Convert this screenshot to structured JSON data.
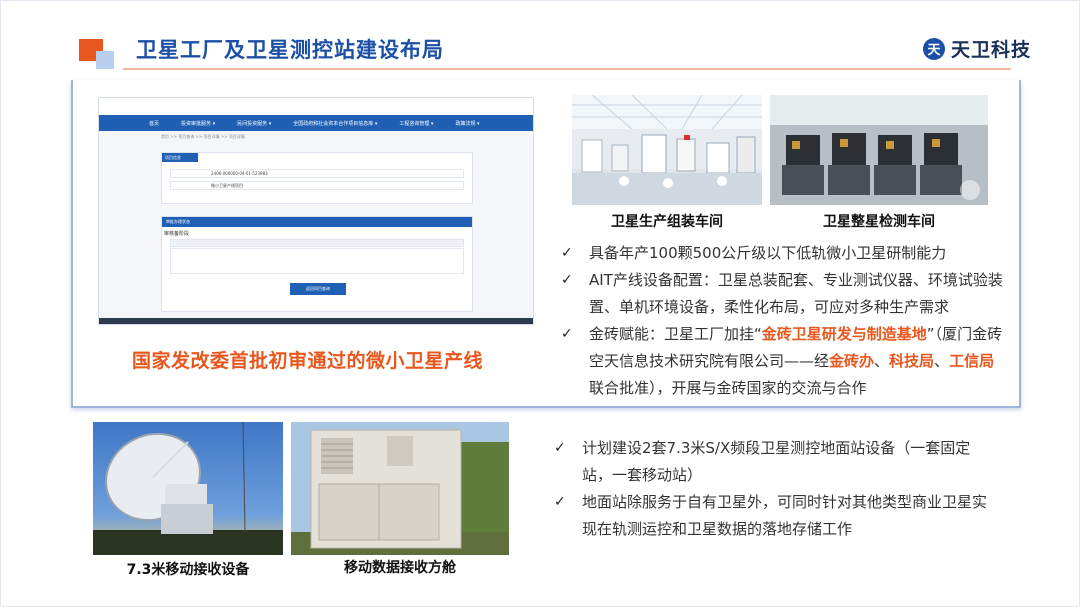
{
  "slide": {
    "title": "卫星工厂及卫星测控站建设布局",
    "logo_mark": "天",
    "logo_text": "天卫科技"
  },
  "website": {
    "nav": [
      "首页",
      "投资审批服务 ▾",
      "民间投资服务 ▾",
      "全国政府和社会资本合作项目信息库 ▾",
      "工程咨询管理 ▾",
      "政策法规 ▾"
    ],
    "crumb": "首页 >> 项目查询 >> 项目详情 >> 项目详情",
    "project_info_label": "项目信息",
    "rows": [
      {
        "label": "项目代码",
        "value": "2406-000000-04-01-523983"
      },
      {
        "label": "项目名称",
        "value": "微小卫星产线项目"
      }
    ],
    "status_bar": "审批办理状态",
    "stage_label": "审核备阶段",
    "submit_button": "返回项目查询"
  },
  "left_caption": "国家发改委首批初审通过的微小卫星产线",
  "photos": {
    "workshop_caption": "卫星生产组装车间",
    "test_caption": "卫星整星检测车间",
    "antenna_caption": "7.3米移动接收设备",
    "cabin_caption": "移动数据接收方舱"
  },
  "check_mark": "✓",
  "bullets_top": [
    {
      "parts": [
        {
          "t": "具备年产100颗500公斤级以下低轨微小卫星研制能力",
          "hl": false
        }
      ]
    },
    {
      "parts": [
        {
          "t": "AIT产线设备配置：卫星总装配套、专业测试仪器、环境试验装置、单机环境设备，柔性化布局，可应对多种生产需求",
          "hl": false
        }
      ]
    },
    {
      "parts": [
        {
          "t": "金砖赋能：卫星工厂加挂“",
          "hl": false
        },
        {
          "t": "金砖卫星研发与制造基地",
          "hl": true
        },
        {
          "t": "”（厦门金砖空天信息技术研究院有限公司——经",
          "hl": false
        },
        {
          "t": "金砖办",
          "hl": true
        },
        {
          "t": "、",
          "hl": false
        },
        {
          "t": "科技局",
          "hl": true
        },
        {
          "t": "、",
          "hl": false
        },
        {
          "t": "工信局",
          "hl": true
        },
        {
          "t": "联合批准），开展与金砖国家的交流与合作",
          "hl": false
        }
      ]
    }
  ],
  "bullets_bottom": [
    {
      "parts": [
        {
          "t": "计划建设2套7.3米S/X频段卫星测控地面站设备（一套固定站，一套移动站）",
          "hl": false
        }
      ]
    },
    {
      "parts": [
        {
          "t": "地面站除服务于自有卫星外，可同时针对其他类型商业卫星实现在轨测运控和卫星数据的落地存储工作",
          "hl": false
        }
      ]
    }
  ],
  "colors": {
    "brand_blue": "#1c4fa6",
    "accent_orange": "#e8571e"
  }
}
